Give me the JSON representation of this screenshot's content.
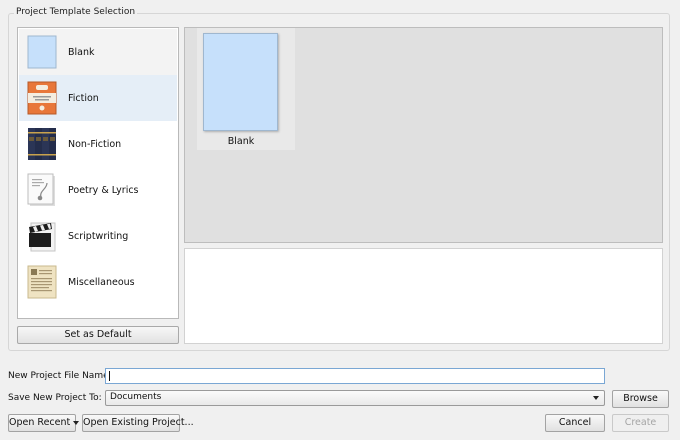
{
  "group_title": "Project Template Selection",
  "categories": [
    {
      "label": "Blank",
      "icon": "blank-page-icon"
    },
    {
      "label": "Fiction",
      "icon": "fiction-book-icon"
    },
    {
      "label": "Non-Fiction",
      "icon": "books-icon"
    },
    {
      "label": "Poetry & Lyrics",
      "icon": "poetry-page-icon"
    },
    {
      "label": "Scriptwriting",
      "icon": "clapperboard-icon"
    },
    {
      "label": "Miscellaneous",
      "icon": "misc-page-icon"
    }
  ],
  "set_default_label": "Set as Default",
  "templates": [
    {
      "name": "Blank",
      "thumb_color": "#c6e0fb"
    }
  ],
  "file_name": {
    "label": "New Project File Name:",
    "value": ""
  },
  "save_to": {
    "label": "Save New Project To:",
    "value": "Documents"
  },
  "buttons": {
    "browse": "Browse",
    "open_recent": "Open Recent",
    "open_existing": "Open Existing Project...",
    "cancel": "Cancel",
    "create": "Create"
  },
  "colors": {
    "hover": "#e5eef7",
    "selected": "#f3f3f3",
    "focus_border": "#7aa7d4"
  }
}
